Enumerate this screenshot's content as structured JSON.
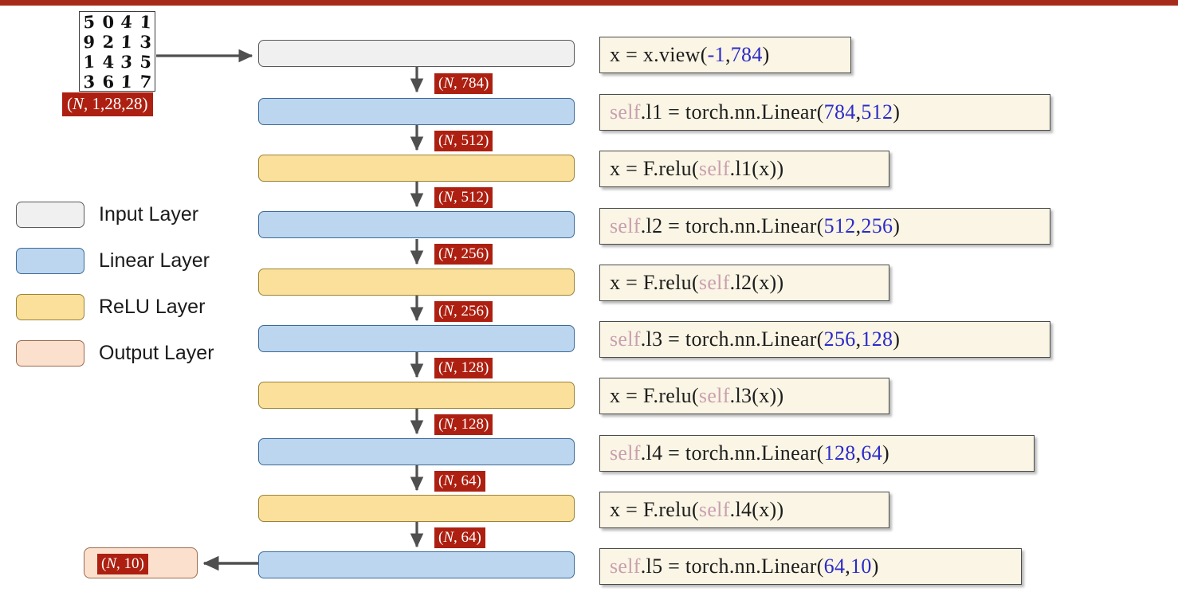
{
  "banner": {
    "color": "#a72b1b"
  },
  "colors": {
    "tag_bg": "#ad2011",
    "input_fill": "#f0f0f0",
    "linear_fill": "#bcd6ef",
    "relu_fill": "#fbe09c",
    "output_fill": "#fbe0cd",
    "code_bg": "#faf5e4",
    "code_self": "#c9a0b0",
    "code_number": "#2b2bc9",
    "arrow": "#4f4f4f"
  },
  "input_sample": {
    "caption_open": "(",
    "caption_n": "N",
    "caption_rest": ", 1,28,28)",
    "digits": [
      "5",
      "0",
      "4",
      "1",
      "9",
      "2",
      "1",
      "3",
      "1",
      "4",
      "3",
      "5",
      "3",
      "6",
      "1",
      "7"
    ]
  },
  "legend": {
    "items": [
      {
        "label": "Input Layer",
        "swatch": "input"
      },
      {
        "label": "Linear Layer",
        "swatch": "linear"
      },
      {
        "label": "ReLU Layer",
        "swatch": "relu"
      },
      {
        "label": "Output Layer",
        "swatch": "output"
      }
    ]
  },
  "flow": {
    "layers": [
      {
        "kind": "input",
        "name": "input-layer"
      },
      {
        "kind": "linear",
        "name": "linear-layer-1"
      },
      {
        "kind": "relu",
        "name": "relu-layer-1"
      },
      {
        "kind": "linear",
        "name": "linear-layer-2"
      },
      {
        "kind": "relu",
        "name": "relu-layer-2"
      },
      {
        "kind": "linear",
        "name": "linear-layer-3"
      },
      {
        "kind": "relu",
        "name": "relu-layer-3"
      },
      {
        "kind": "linear",
        "name": "linear-layer-4"
      },
      {
        "kind": "relu",
        "name": "relu-layer-4"
      },
      {
        "kind": "linear",
        "name": "linear-layer-5"
      }
    ],
    "shape_tags": [
      {
        "open": "(",
        "n": "N",
        "rest": ", 784)"
      },
      {
        "open": "(",
        "n": "N",
        "rest": ", 512)"
      },
      {
        "open": "(",
        "n": "N",
        "rest": ", 512)"
      },
      {
        "open": "(",
        "n": "N",
        "rest": ", 256)"
      },
      {
        "open": "(",
        "n": "N",
        "rest": ", 256)"
      },
      {
        "open": "(",
        "n": "N",
        "rest": ", 128)"
      },
      {
        "open": "(",
        "n": "N",
        "rest": ", 128)"
      },
      {
        "open": "(",
        "n": "N",
        "rest": ", 64)"
      },
      {
        "open": "(",
        "n": "N",
        "rest": ", 64)"
      }
    ]
  },
  "output": {
    "open": "(",
    "n": "N",
    "rest": ", 10)"
  },
  "code": {
    "lines": [
      {
        "id": "view",
        "pre": "x = x.view(",
        "self": "",
        "mid": "",
        "num1": "-1",
        "sep": ",  ",
        "num2": "784",
        "post": ")"
      },
      {
        "id": "linear1",
        "pre": "",
        "self": "self",
        "mid": ".l1 = torch.nn.Linear(",
        "num1": "784",
        "sep": ",  ",
        "num2": "512",
        "post": ")"
      },
      {
        "id": "relu1",
        "pre": "x = F.relu(",
        "self": "self",
        "mid": ".l1(x))",
        "num1": "",
        "sep": "",
        "num2": "",
        "post": ""
      },
      {
        "id": "linear2",
        "pre": "",
        "self": "self",
        "mid": ".l2 = torch.nn.Linear(",
        "num1": "512",
        "sep": ",  ",
        "num2": "256",
        "post": ")"
      },
      {
        "id": "relu2",
        "pre": "x = F.relu(",
        "self": "self",
        "mid": ".l2(x))",
        "num1": "",
        "sep": "",
        "num2": "",
        "post": ""
      },
      {
        "id": "linear3",
        "pre": "",
        "self": "self",
        "mid": ".l3 = torch.nn.Linear(",
        "num1": "256",
        "sep": ",  ",
        "num2": "128",
        "post": ")"
      },
      {
        "id": "relu3",
        "pre": "x = F.relu(",
        "self": "self",
        "mid": ".l3(x))",
        "num1": "",
        "sep": "",
        "num2": "",
        "post": ""
      },
      {
        "id": "linear4",
        "pre": "",
        "self": "self",
        "mid": ".l4 = torch.nn.Linear(",
        "num1": "128",
        "sep": ",  ",
        "num2": "64",
        "post": ")"
      },
      {
        "id": "relu4",
        "pre": "x = F.relu(",
        "self": "self",
        "mid": ".l4(x))",
        "num1": "",
        "sep": "",
        "num2": "",
        "post": ""
      },
      {
        "id": "linear5",
        "pre": "",
        "self": "self",
        "mid": ".l5 = torch.nn.Linear(",
        "num1": "64",
        "sep": ",  ",
        "num2": "10",
        "post": ")"
      }
    ]
  }
}
